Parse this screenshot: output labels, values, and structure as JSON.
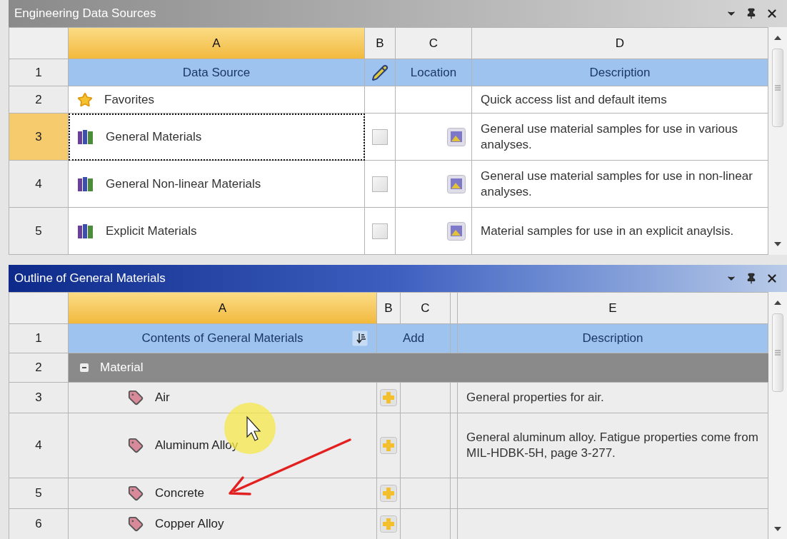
{
  "sources_panel": {
    "title": "Engineering Data Sources",
    "active": false,
    "columns": [
      {
        "letter": "A",
        "selected": true
      },
      {
        "letter": "B",
        "selected": false
      },
      {
        "letter": "C",
        "selected": false
      },
      {
        "letter": "D",
        "selected": false
      }
    ],
    "header": {
      "number": "1",
      "data_source": "Data Source",
      "location": "Location",
      "description": "Description"
    },
    "rows": [
      {
        "number": "2",
        "kind": "favorites",
        "name": "Favorites",
        "selected": false,
        "description": "Quick access list and default items"
      },
      {
        "number": "3",
        "kind": "library",
        "name": "General Materials",
        "selected": true,
        "checked": false,
        "description": "General use material samples for use in various analyses."
      },
      {
        "number": "4",
        "kind": "library",
        "name": "General Non-linear Materials",
        "selected": false,
        "checked": false,
        "description": "General use material samples for use in non-linear analyses."
      },
      {
        "number": "5",
        "kind": "library",
        "name": "Explicit Materials",
        "selected": false,
        "checked": false,
        "description": "Material samples for use in an explicit anaylsis."
      }
    ]
  },
  "outline_panel": {
    "title": "Outline of General Materials",
    "active": true,
    "columns": [
      {
        "letter": "A",
        "selected": true
      },
      {
        "letter": "B",
        "selected": false
      },
      {
        "letter": "C",
        "selected": false
      },
      {
        "letter": "E",
        "selected": false
      }
    ],
    "header": {
      "number": "1",
      "contents": "Contents of General Materials",
      "add": "Add",
      "description": "Description"
    },
    "group": {
      "number": "2",
      "name": "Material",
      "expanded": true,
      "children": [
        {
          "number": "3",
          "name": "Air",
          "description": "General properties for air."
        },
        {
          "number": "4",
          "name": "Aluminum Alloy",
          "description": "General aluminum alloy. Fatigue properties come from MIL-HDBK-5H, page 3-277."
        },
        {
          "number": "5",
          "name": "Concrete"
        },
        {
          "number": "6",
          "name": "Copper Alloy"
        }
      ]
    }
  }
}
